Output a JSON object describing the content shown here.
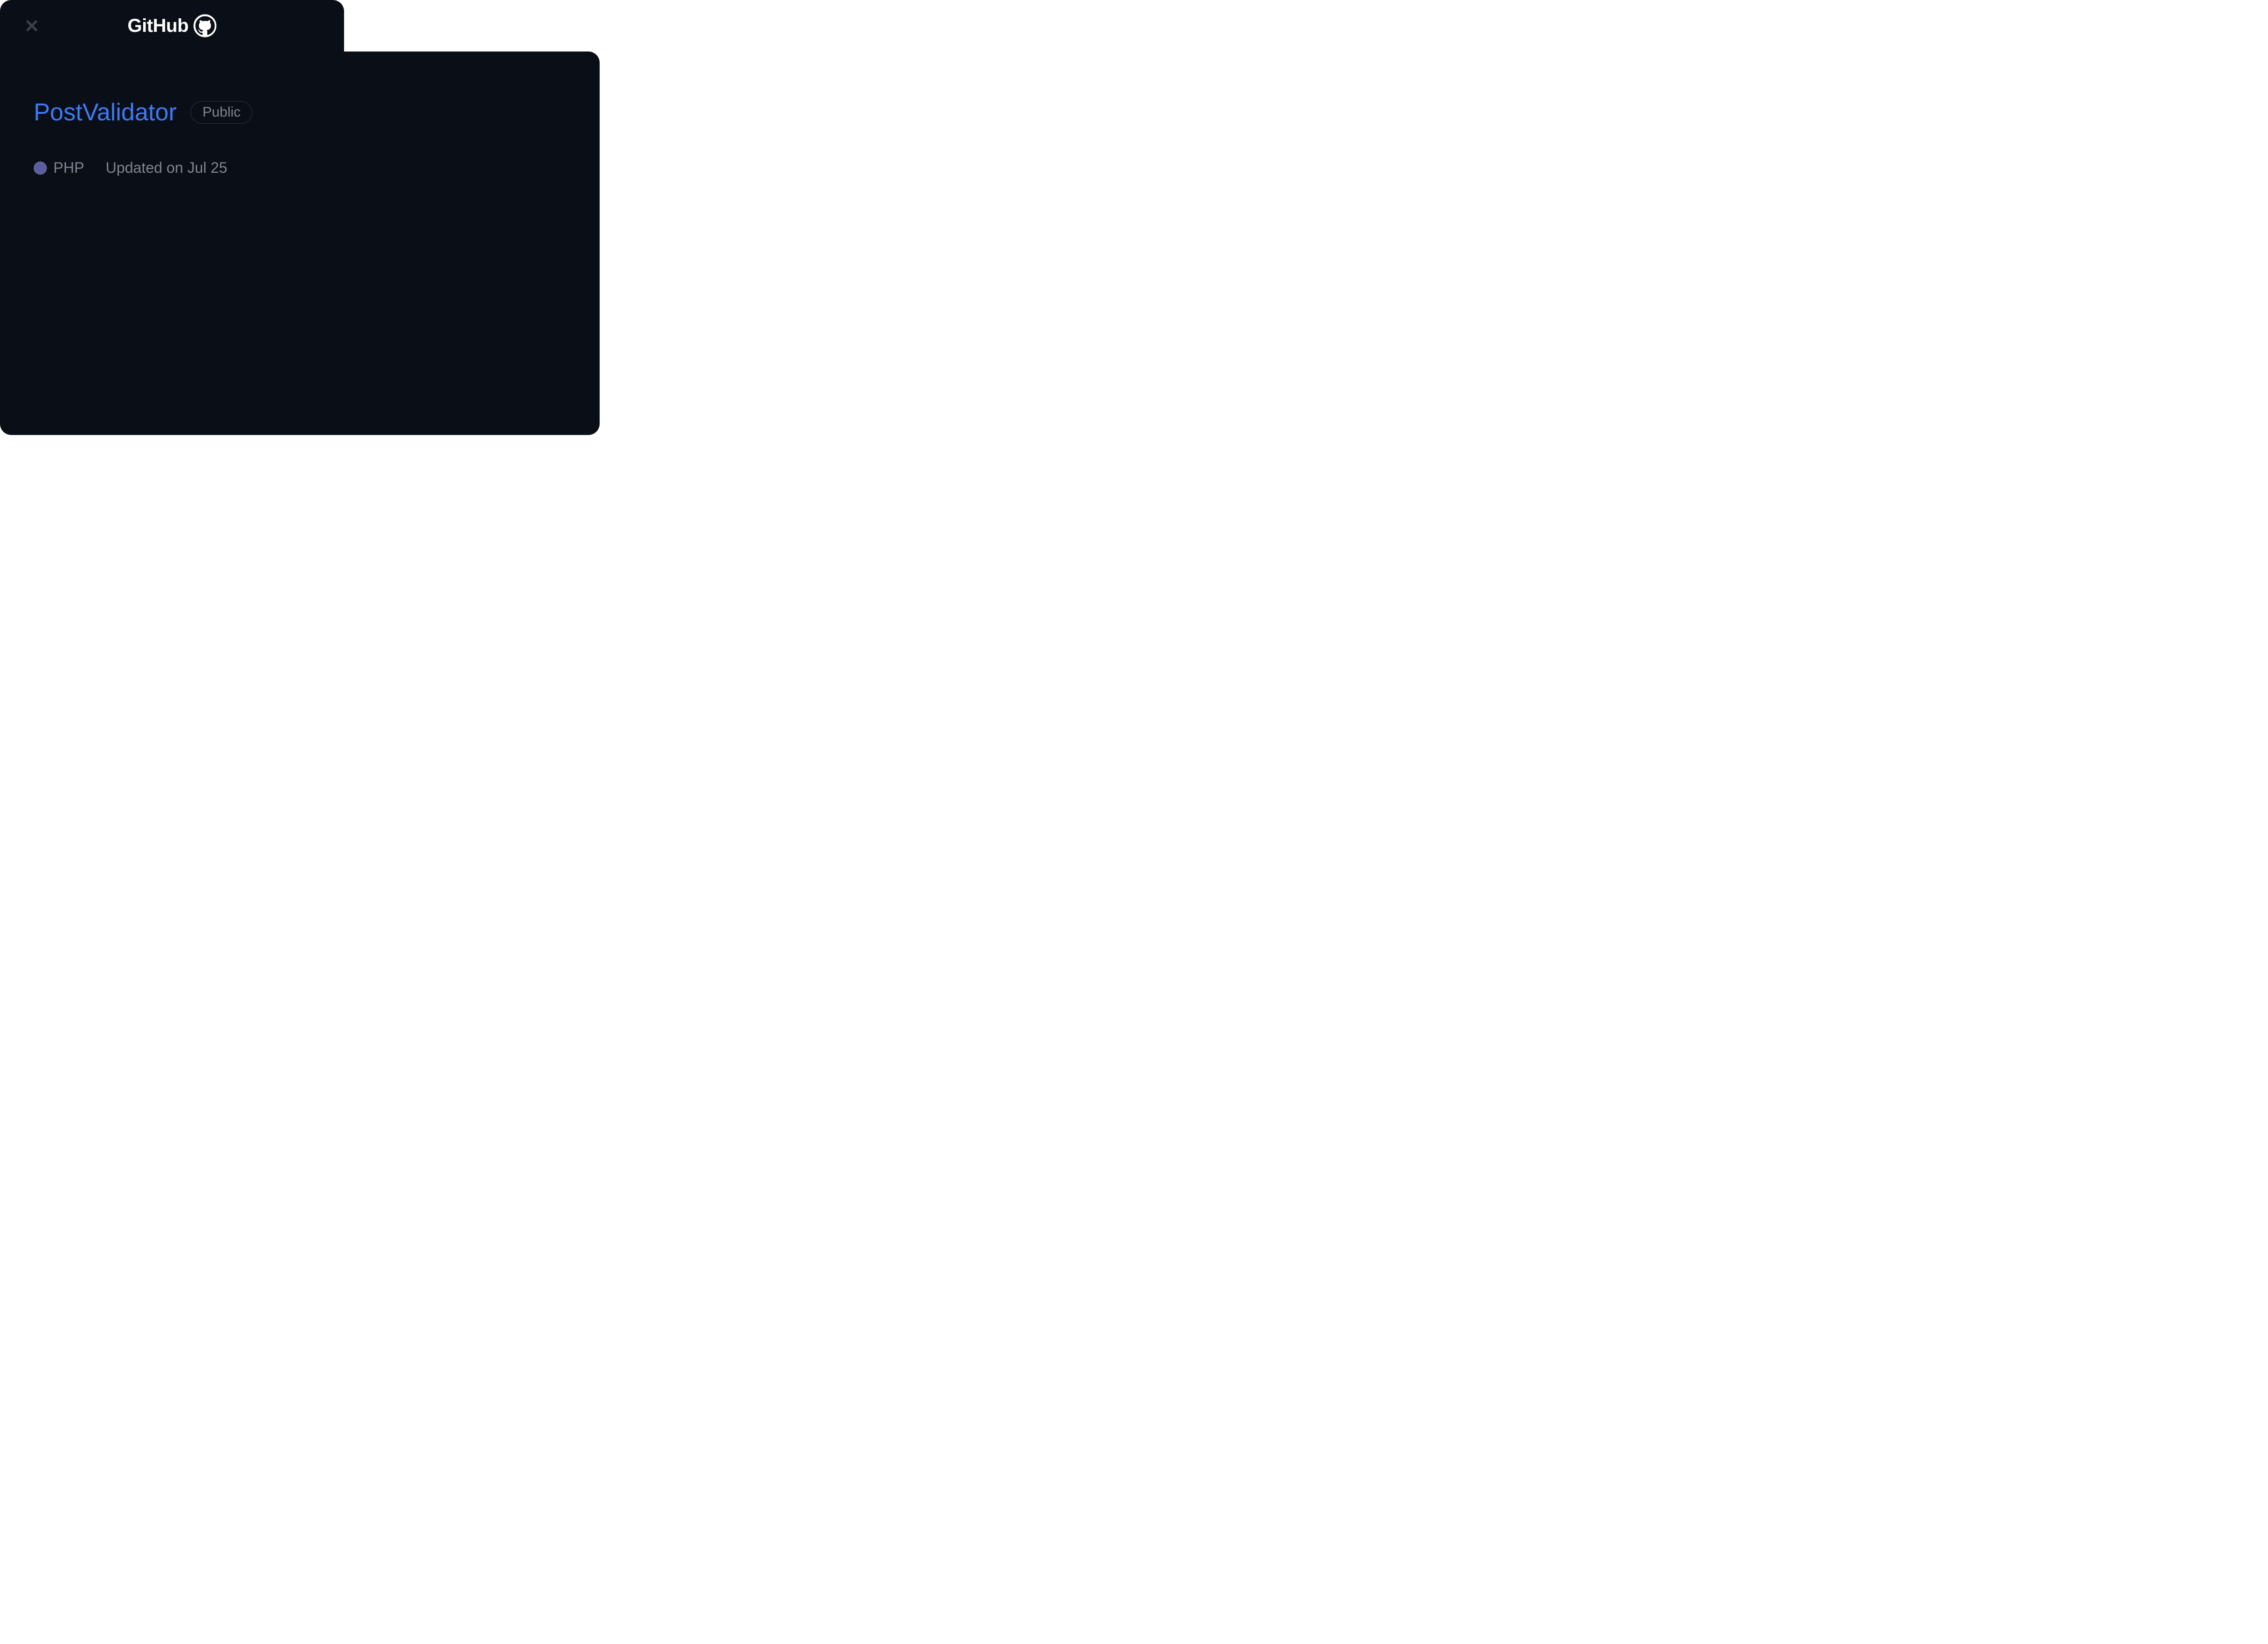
{
  "tab": {
    "service_name": "GitHub"
  },
  "repo": {
    "name": "PostValidator",
    "visibility": "Public",
    "language": "PHP",
    "language_color": "#5a5e9c",
    "updated": "Updated on Jul 25"
  }
}
